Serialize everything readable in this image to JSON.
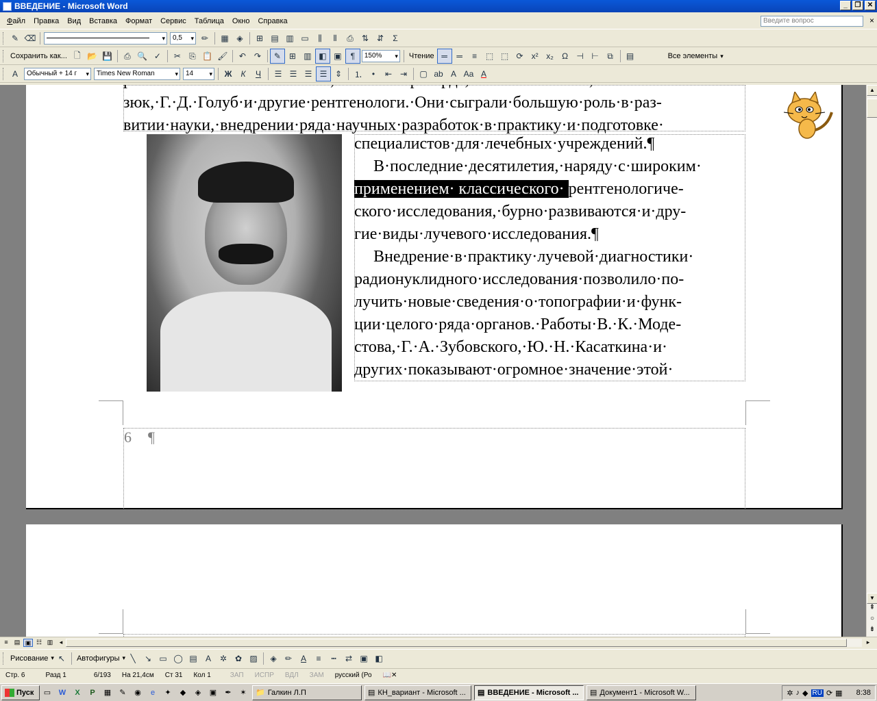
{
  "window": {
    "title": "ВВЕДЕНИЕ - Microsoft Word"
  },
  "menu": {
    "items": [
      "Файл",
      "Правка",
      "Вид",
      "Вставка",
      "Формат",
      "Сервис",
      "Таблица",
      "Окно",
      "Справка"
    ],
    "ask_placeholder": "Введите вопрос"
  },
  "toolbar1": {
    "line_weight": "0,5"
  },
  "toolbar2": {
    "save_as": "Сохранить как...",
    "zoom": "150%",
    "reading": "Чтение",
    "all_elements": "Все элементы"
  },
  "toolbar3": {
    "style": "Обычный + 14 г",
    "font": "Times New Roman",
    "size": "14"
  },
  "document": {
    "top_lines": [
      "рентгенологию·Б.·М.·Сосина,·М.·М.·Маркварде,·А.·Н.·Михайлов,·И.·И.·Ла-",
      "зюк,·Г.·Д.·Голуб·и·другие·рентгенологи.·Они·сыграли·большую·роль·в·раз-",
      "витии·науки,·внедрении·ряда·научных·разработок·в·практику·и·подготовке·"
    ],
    "side_lines": [
      "специалистов·для·лечебных·учреждений.¶",
      "В·последние·десятилетия,·наряду·с·широким·",
      "ского·исследования,·бурно·развиваются·и·дру-",
      "гие·виды·лучевого·исследования.¶",
      "Внедрение·в·практику·лучевой·диагностики·",
      "радионуклидного·исследования·позволило·по-",
      "лучить·новые·сведения·о·топографии·и·функ-",
      "ции·целого·ряда·органов.·Работы·В.·К.·Моде-",
      "стова,·Г.·А.·Зубовского,·Ю.·Н.·Касаткина·и·",
      "других·показывают·огромное·значение·этой·"
    ],
    "selected_text": "применением· классического· ",
    "after_selection": "рентгенологиче-",
    "page_number": "6",
    "pilcrow": "¶"
  },
  "drawing_toolbar": {
    "drawing": "Рисование",
    "autoshapes": "Автофигуры"
  },
  "status": {
    "page": "Стр. 6",
    "section": "Разд 1",
    "pages": "6/193",
    "at": "На 21,4см",
    "line": "Ст 31",
    "col": "Кол 1",
    "rec": "ЗАП",
    "trk": "ИСПР",
    "ext": "ВДЛ",
    "ovr": "ЗАМ",
    "language": "русский (Ро"
  },
  "taskbar": {
    "start": "Пуск",
    "tasks": [
      "Галкин Л.П",
      "КН_вариант - Microsoft ...",
      "ВВЕДЕНИЕ - Microsoft ...",
      "Документ1 - Microsoft W..."
    ],
    "lang": "RU",
    "clock": "8:38"
  }
}
